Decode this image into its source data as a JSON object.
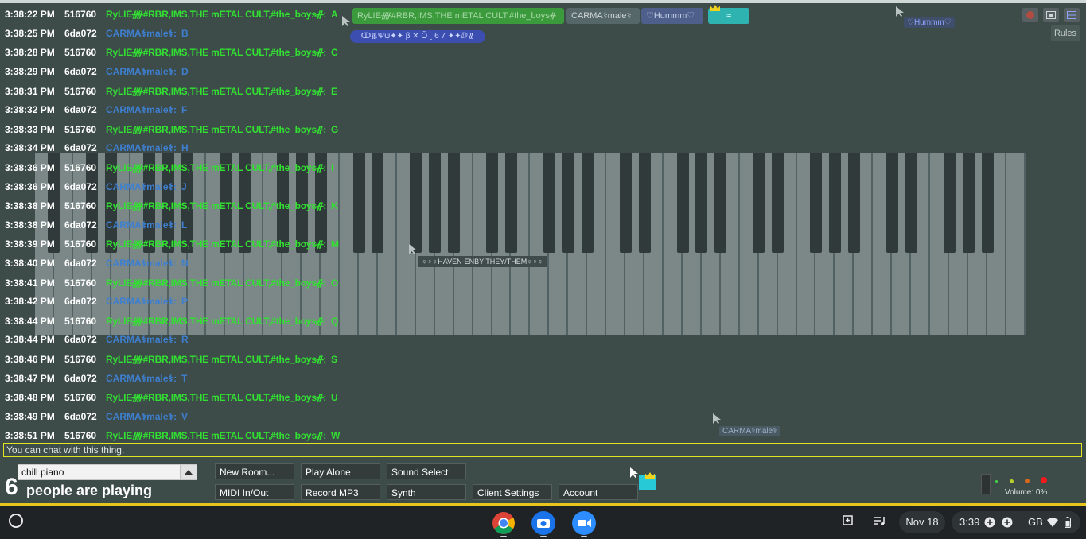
{
  "participants": [
    {
      "name": "RyLIEᚎ#RBR,IMS,THE mETAL CULT,#the_boysᚌ",
      "style": "green"
    },
    {
      "name": "CARMA⚕male⚕",
      "style": "gray"
    },
    {
      "name": "♡Hummm♡",
      "style": "blue"
    },
    {
      "name": "≈",
      "style": "teal"
    }
  ],
  "ticker": "ↀ᯾Ψψ✦✦ β ✕ Ǒ ˍ 6 7 ✦✦ⅅ᯾",
  "rules_label": "Rules",
  "floating_labels": {
    "hummm": "♡Hummm♡",
    "carma_cursor": "CARMA⚕male⚕",
    "haven": "♀♀♀HAVEN-ENBY-THEY/THEM♀♀♀"
  },
  "chat": [
    {
      "time": "3:38:22 PM",
      "uid": "516760",
      "name": "RyLIEᚎ#RBR,IMS,THE mETAL CULT,#the_boysᚌ:",
      "text": "A",
      "color": "green"
    },
    {
      "time": "3:38:25 PM",
      "uid": "6da072",
      "name": "CARMA⚕male⚕:",
      "text": "B",
      "color": "blue"
    },
    {
      "time": "3:38:28 PM",
      "uid": "516760",
      "name": "RyLIEᚎ#RBR,IMS,THE mETAL CULT,#the_boysᚌ:",
      "text": "C",
      "color": "green"
    },
    {
      "time": "3:38:29 PM",
      "uid": "6da072",
      "name": "CARMA⚕male⚕:",
      "text": "D",
      "color": "blue"
    },
    {
      "time": "3:38:31 PM",
      "uid": "516760",
      "name": "RyLIEᚎ#RBR,IMS,THE mETAL CULT,#the_boysᚌ:",
      "text": "E",
      "color": "green"
    },
    {
      "time": "3:38:32 PM",
      "uid": "6da072",
      "name": "CARMA⚕male⚕:",
      "text": "F",
      "color": "blue"
    },
    {
      "time": "3:38:33 PM",
      "uid": "516760",
      "name": "RyLIEᚎ#RBR,IMS,THE mETAL CULT,#the_boysᚌ:",
      "text": "G",
      "color": "green"
    },
    {
      "time": "3:38:34 PM",
      "uid": "6da072",
      "name": "CARMA⚕male⚕:",
      "text": "H",
      "color": "blue"
    },
    {
      "time": "3:38:36 PM",
      "uid": "516760",
      "name": "RyLIEᚎ#RBR,IMS,THE mETAL CULT,#the_boysᚌ:",
      "text": "I",
      "color": "green"
    },
    {
      "time": "3:38:36 PM",
      "uid": "6da072",
      "name": "CARMA⚕male⚕:",
      "text": "J",
      "color": "blue"
    },
    {
      "time": "3:38:38 PM",
      "uid": "516760",
      "name": "RyLIEᚎ#RBR,IMS,THE mETAL CULT,#the_boysᚌ:",
      "text": "K",
      "color": "green"
    },
    {
      "time": "3:38:38 PM",
      "uid": "6da072",
      "name": "CARMA⚕male⚕:",
      "text": "L",
      "color": "blue"
    },
    {
      "time": "3:38:39 PM",
      "uid": "516760",
      "name": "RyLIEᚎ#RBR,IMS,THE mETAL CULT,#the_boysᚌ:",
      "text": "M",
      "color": "green"
    },
    {
      "time": "3:38:40 PM",
      "uid": "6da072",
      "name": "CARMA⚕male⚕:",
      "text": "N",
      "color": "blue"
    },
    {
      "time": "3:38:41 PM",
      "uid": "516760",
      "name": "RyLIEᚎ#RBR,IMS,THE mETAL CULT,#the_boysᚌ:",
      "text": "O",
      "color": "green"
    },
    {
      "time": "3:38:42 PM",
      "uid": "6da072",
      "name": "CARMA⚕male⚕:",
      "text": "P",
      "color": "blue"
    },
    {
      "time": "3:38:44 PM",
      "uid": "516760",
      "name": "RyLIEᚎ#RBR,IMS,THE mETAL CULT,#the_boysᚌ:",
      "text": "Q",
      "color": "green"
    },
    {
      "time": "3:38:44 PM",
      "uid": "6da072",
      "name": "CARMA⚕male⚕:",
      "text": "R",
      "color": "blue"
    },
    {
      "time": "3:38:46 PM",
      "uid": "516760",
      "name": "RyLIEᚎ#RBR,IMS,THE mETAL CULT,#the_boysᚌ:",
      "text": "S",
      "color": "green"
    },
    {
      "time": "3:38:47 PM",
      "uid": "6da072",
      "name": "CARMA⚕male⚕:",
      "text": "T",
      "color": "blue"
    },
    {
      "time": "3:38:48 PM",
      "uid": "516760",
      "name": "RyLIEᚎ#RBR,IMS,THE mETAL CULT,#the_boysᚌ:",
      "text": "U",
      "color": "green"
    },
    {
      "time": "3:38:49 PM",
      "uid": "6da072",
      "name": "CARMA⚕male⚕:",
      "text": "V",
      "color": "blue"
    },
    {
      "time": "3:38:51 PM",
      "uid": "516760",
      "name": "RyLIEᚎ#RBR,IMS,THE mETAL CULT,#the_boysᚌ:",
      "text": "W",
      "color": "green"
    }
  ],
  "chat_input": {
    "placeholder": "You can chat with this thing."
  },
  "room": {
    "selected": "chill piano"
  },
  "player_count": {
    "number": "6",
    "text": "people are playing"
  },
  "buttons": {
    "new_room": "New Room...",
    "play_alone": "Play Alone",
    "sound_select": "Sound Select",
    "midi": "MIDI In/Out",
    "record_mp3": "Record MP3",
    "synth": "Synth",
    "client_settings": "Client Settings",
    "account": "Account"
  },
  "volume": {
    "label": "Volume: 0%",
    "level": 0
  },
  "taskbar": {
    "date": "Nov 18",
    "time": "3:39",
    "locale": "GB",
    "apps": [
      "chrome-icon",
      "camera-icon",
      "zoom-icon"
    ]
  },
  "colors": {
    "chat_green": "#32e032",
    "chat_blue": "#3e7fd0",
    "chatbox_border": "#e1e51f",
    "taskbar_accent": "#e7c51a"
  }
}
